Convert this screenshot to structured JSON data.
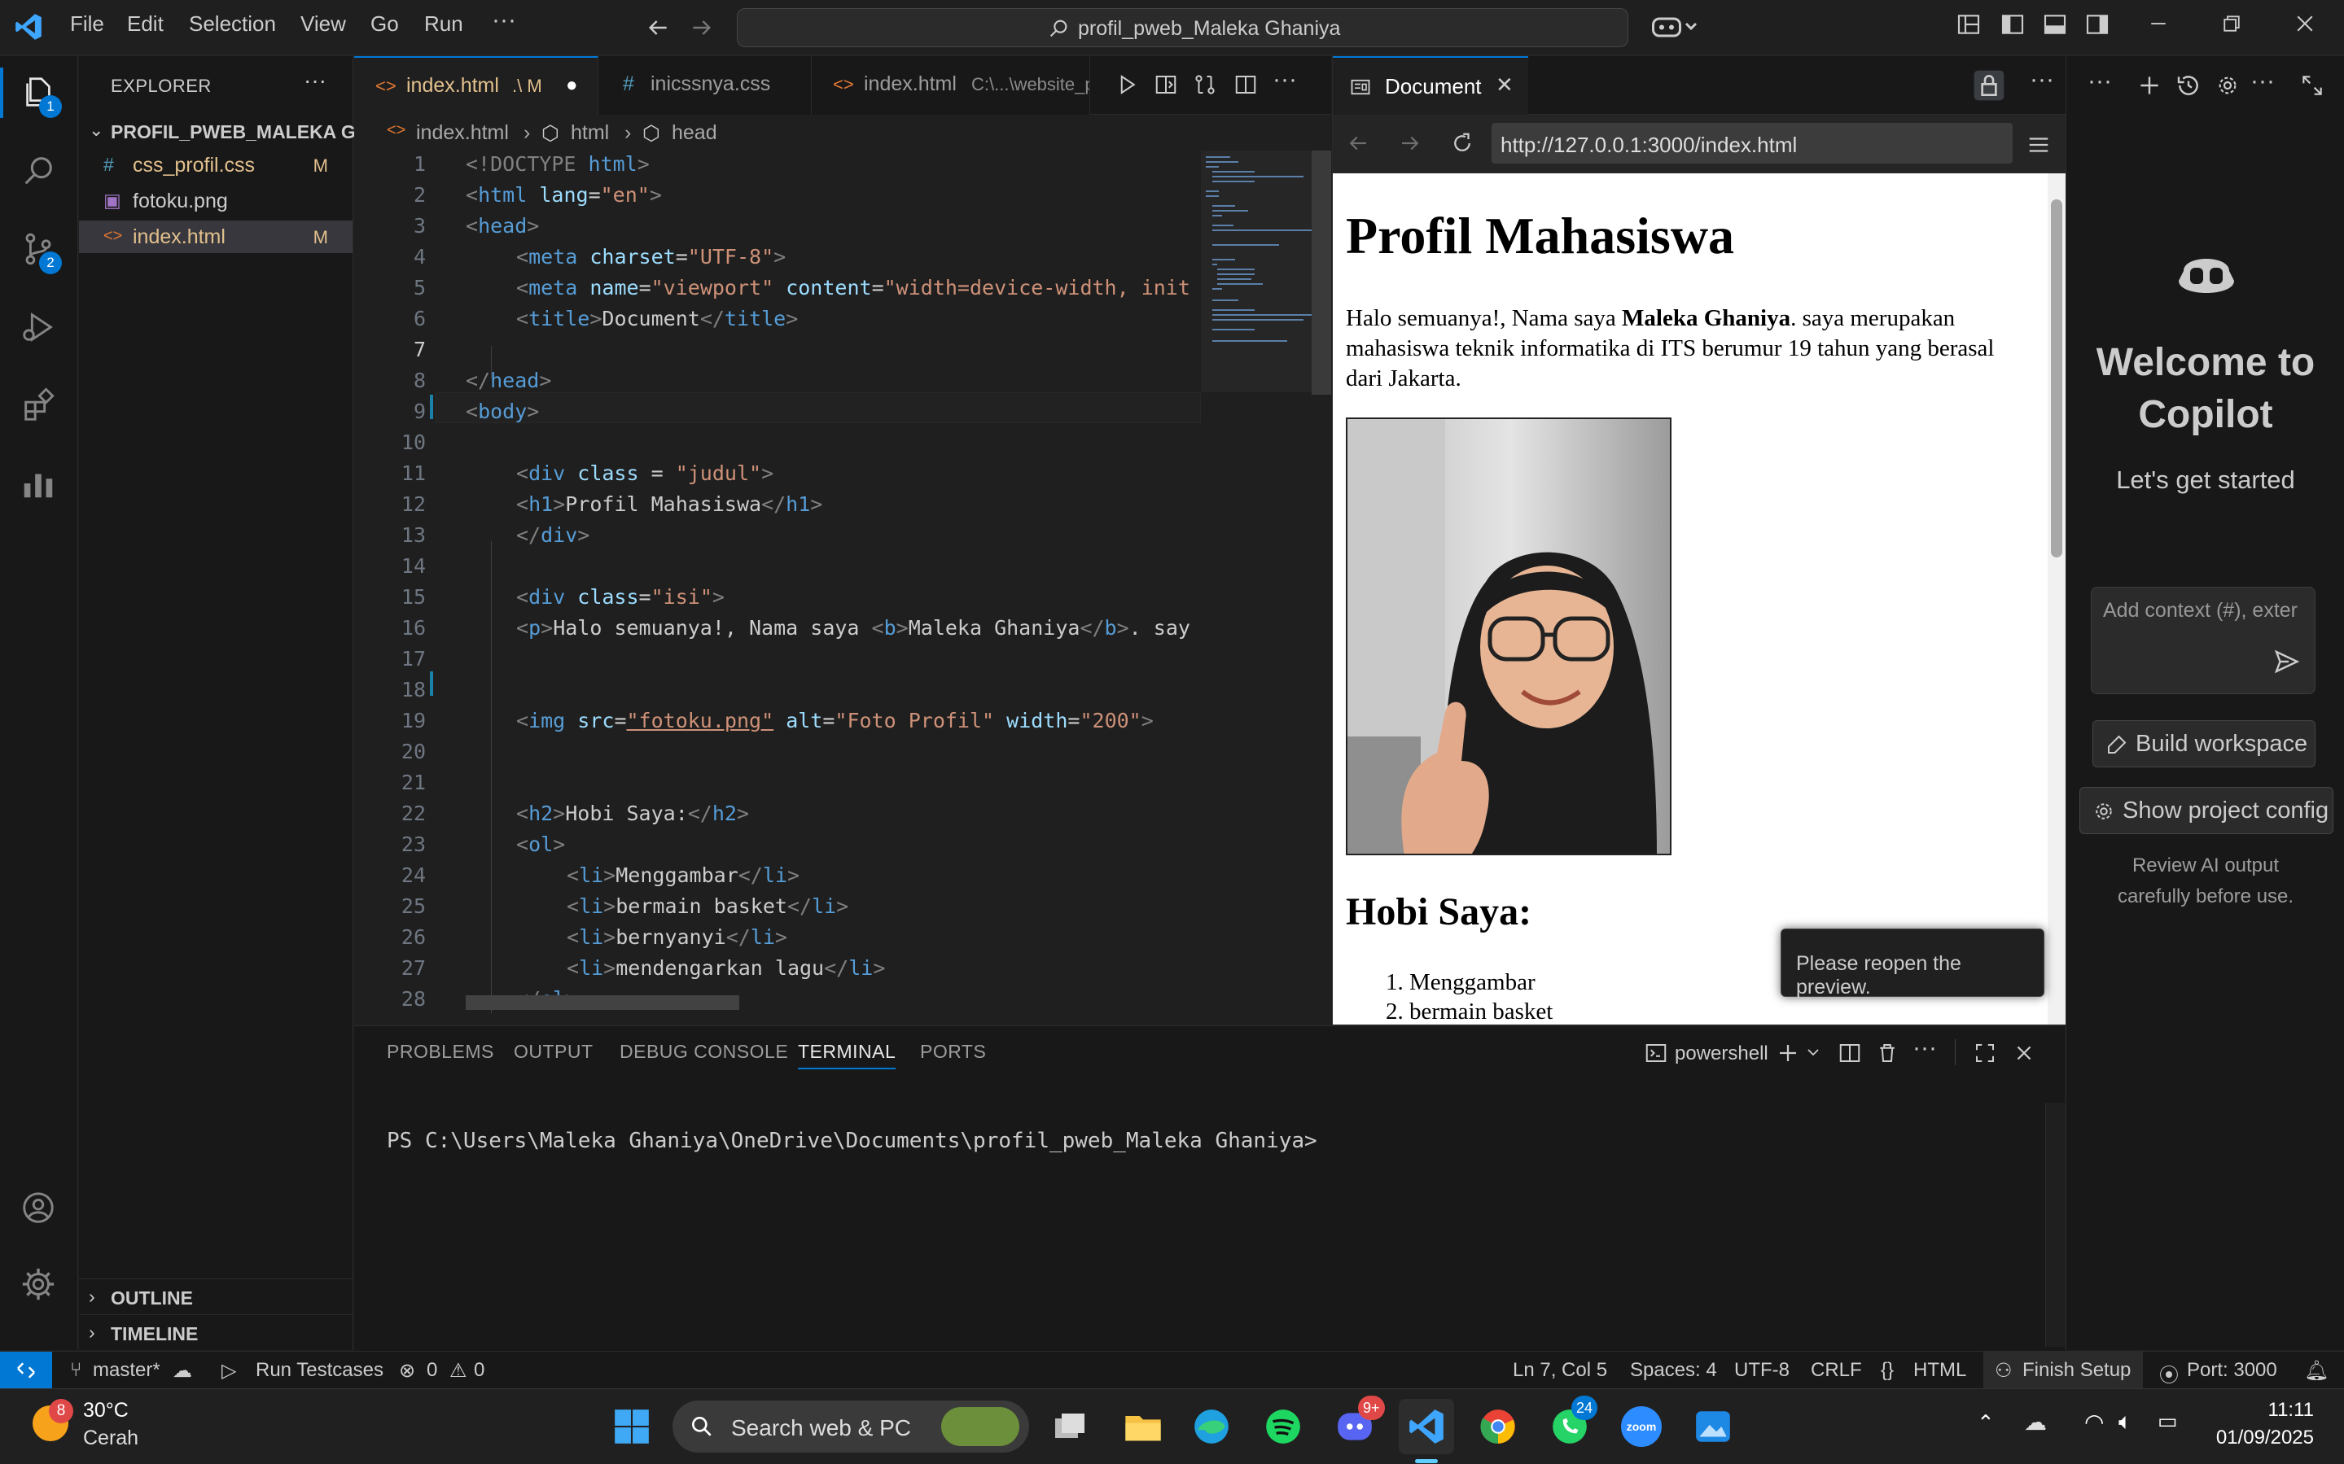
{
  "titlebar": {
    "menu": [
      "File",
      "Edit",
      "Selection",
      "View",
      "Go",
      "Run",
      "···"
    ],
    "search_text": "profil_pweb_Maleka Ghaniya"
  },
  "activity": {
    "explorer_badge": "1",
    "scm_badge": "2"
  },
  "sidebar": {
    "title": "EXPLORER",
    "more": "···",
    "folder": "PROFIL_PWEB_MALEKA G...",
    "files": [
      {
        "icon": "#",
        "name": "css_profil.css",
        "status": "M"
      },
      {
        "icon": "▣",
        "name": "fotoku.png",
        "status": ""
      },
      {
        "icon": "<>",
        "name": "index.html",
        "status": "M"
      }
    ],
    "outline": "OUTLINE",
    "timeline": "TIMELINE"
  },
  "editor": {
    "tabs": [
      {
        "icon": "<>",
        "label": "index.html",
        "desc": ".\\ M",
        "dirty": "●"
      },
      {
        "icon": "#",
        "label": "inicssnya.css",
        "desc": ""
      },
      {
        "icon": "<>",
        "label": "index.html",
        "desc": "C:\\...\\website_p"
      }
    ],
    "breadcrumb": [
      "index.html",
      "html",
      "head"
    ],
    "line_numbers": [
      "1",
      "2",
      "3",
      "4",
      "5",
      "6",
      "7",
      "8",
      "9",
      "10",
      "11",
      "12",
      "13",
      "14",
      "15",
      "16",
      "17",
      "18",
      "19",
      "20",
      "21",
      "22",
      "23",
      "24",
      "25",
      "26",
      "27",
      "28"
    ]
  },
  "code": {
    "l1": [
      "<!DOCTYPE ",
      "html",
      ">"
    ],
    "l2": [
      "<",
      "html",
      " ",
      "lang",
      "=",
      "\"en\"",
      ">"
    ],
    "l3": [
      "<",
      "head",
      ">"
    ],
    "l4": [
      "<",
      "meta",
      " ",
      "charset",
      "=",
      "\"UTF-8\"",
      ">"
    ],
    "l5": [
      "<",
      "meta",
      " ",
      "name",
      "=",
      "\"viewport\"",
      " ",
      "content",
      "=",
      "\"width=device-width, init"
    ],
    "l6": [
      "<",
      "title",
      ">",
      "Document",
      "</",
      "title",
      ">"
    ],
    "l8": [
      "</",
      "head",
      ">"
    ],
    "l9": [
      "<",
      "body",
      ">"
    ],
    "l11": [
      "<",
      "div",
      " ",
      "class",
      " = ",
      "\"judul\"",
      ">"
    ],
    "l12": [
      "<",
      "h1",
      ">",
      "Profil Mahasiswa",
      "</",
      "h1",
      ">"
    ],
    "l13": [
      "</",
      "div",
      ">"
    ],
    "l15": [
      "<",
      "div",
      " ",
      "class",
      "=",
      "\"isi\"",
      ">"
    ],
    "l16": [
      "<",
      "p",
      ">",
      "Halo semuanya!, Nama saya ",
      "<",
      "b",
      ">",
      "Maleka Ghaniya",
      "</",
      "b",
      ">",
      ". say"
    ],
    "l19": [
      "<",
      "img",
      " ",
      "src",
      "=",
      "\"fotoku.png\"",
      " ",
      "alt",
      "=",
      "\"Foto Profil\"",
      " ",
      "width",
      "=",
      "\"200\"",
      ">"
    ],
    "l22": [
      "<",
      "h2",
      ">",
      "Hobi Saya:",
      "</",
      "h2",
      ">"
    ],
    "l23": [
      "<",
      "ol",
      ">"
    ],
    "l24": [
      "<",
      "li",
      ">",
      "Menggambar",
      "</",
      "li",
      ">"
    ],
    "l25": [
      "<",
      "li",
      ">",
      "bermain basket",
      "</",
      "li",
      ">"
    ],
    "l26": [
      "<",
      "li",
      ">",
      "bernyanyi",
      "</",
      "li",
      ">"
    ],
    "l27": [
      "<",
      "li",
      ">",
      "mendengarkan lagu",
      "</",
      "li",
      ">"
    ],
    "l28": [
      "</",
      "ol",
      ">"
    ]
  },
  "preview": {
    "tab_label": "Document",
    "url": "http://127.0.0.1:3000/index.html",
    "h1": "Profil Mahasiswa",
    "p_before": "Halo semuanya!, Nama saya ",
    "p_bold": "Maleka Ghaniya",
    "p_after": ". saya merupakan mahasiswa teknik informatika di ITS berumur 19 tahun yang berasal dari Jakarta.",
    "h2": "Hobi Saya:",
    "list": [
      "Menggambar",
      "bermain basket"
    ],
    "toast": "Please reopen the preview."
  },
  "copilot": {
    "welcome": "Welcome to Copilot",
    "subtitle": "Let's get started",
    "input_placeholder": "Add context (#), exter",
    "build_label": "Build workspace",
    "config_label": "Show project config",
    "note": "Review AI output carefully before use."
  },
  "panel": {
    "tabs": [
      "PROBLEMS",
      "OUTPUT",
      "DEBUG CONSOLE",
      "TERMINAL",
      "PORTS"
    ],
    "shell": "powershell",
    "terminal_line": "PS C:\\Users\\Maleka Ghaniya\\OneDrive\\Documents\\profil_pweb_Maleka Ghaniya>"
  },
  "status": {
    "branch": "master*",
    "run_testcases": "Run Testcases",
    "errors": "0",
    "warnings": "0",
    "position": "Ln 7, Col 5",
    "spaces": "Spaces: 4",
    "encoding": "UTF-8",
    "eol": "CRLF",
    "language": "HTML",
    "finish_setup": "Finish Setup",
    "port": "Port: 3000"
  },
  "taskbar": {
    "weather_temp": "30°C",
    "weather_desc": "Cerah",
    "weather_badge": "8",
    "search_label": "Search web & PC",
    "discord_badge": "9+",
    "whatsapp_badge": "24",
    "time": "11:11",
    "date": "01/09/2025",
    "zoom": "zoom"
  },
  "colors": {
    "accent": "#0078d4",
    "modified": "#e2c08d",
    "tag": "#569cd6",
    "attr": "#9cdcfe",
    "string": "#ce9178"
  }
}
